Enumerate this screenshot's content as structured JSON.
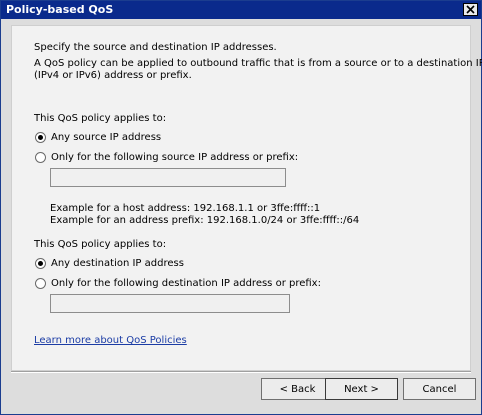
{
  "window": {
    "title": "Policy-based QoS"
  },
  "intro": {
    "heading": "Specify the source and destination IP addresses.",
    "line1": "A QoS policy can be applied to outbound traffic that is from a source or to a destination IP",
    "line2": "(IPv4 or IPv6) address or prefix."
  },
  "source": {
    "applies_label": "This QoS policy applies to:",
    "option_any": "Any source IP address",
    "option_specific": "Only for the following source IP address or prefix:",
    "selected": "any",
    "input_value": "",
    "example_host": "Example for a host address: 192.168.1.1 or 3ffe:ffff::1",
    "example_prefix": "Example for an address prefix: 192.168.1.0/24 or 3ffe:ffff::/64"
  },
  "destination": {
    "applies_label": "This QoS policy applies to:",
    "option_any": "Any destination IP address",
    "option_specific": "Only for the following destination IP address or prefix:",
    "selected": "any",
    "input_value": ""
  },
  "learn_more_link": "Learn more about QoS Policies",
  "buttons": {
    "back": "< Back",
    "next": "Next >",
    "cancel": "Cancel"
  },
  "colors": {
    "titlebar": "#0a2a8c",
    "link": "#1b3ca5"
  },
  "icons": {
    "close": "close-icon"
  }
}
